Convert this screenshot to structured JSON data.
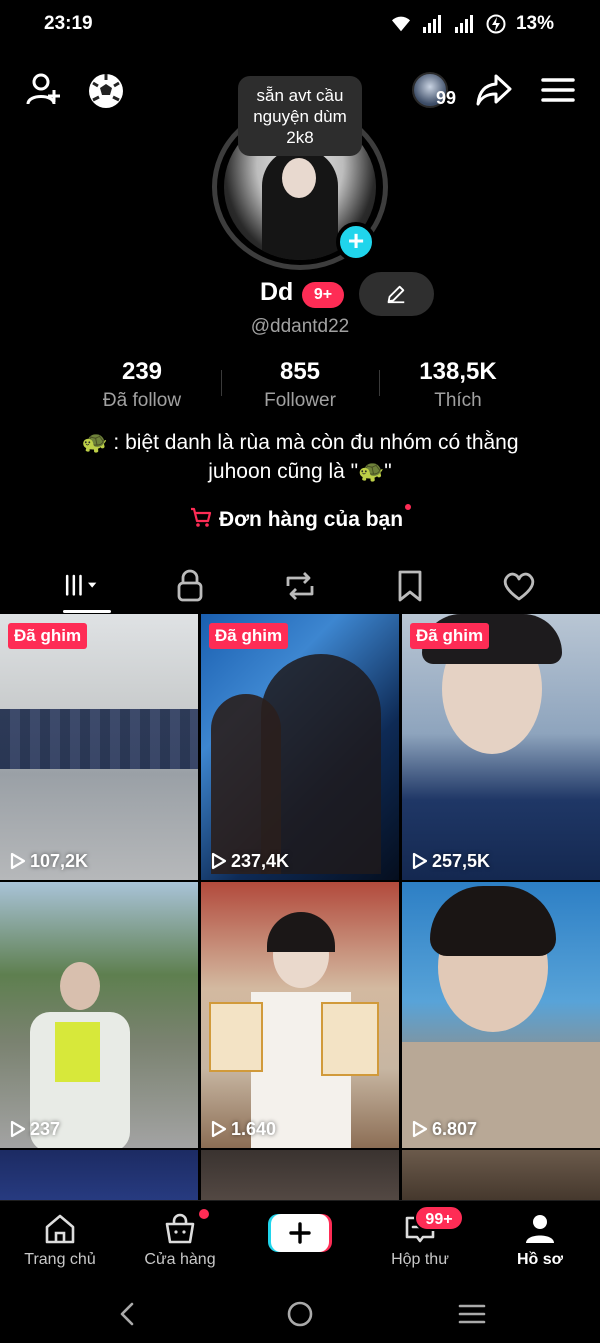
{
  "status_bar": {
    "time": "23:19",
    "battery": "13%"
  },
  "tooltip": {
    "text_line1": "sẵn avt cầu",
    "text_line2": "nguyện dùm",
    "text_line3": "2k8"
  },
  "top_bar": {
    "mini_count": "99"
  },
  "profile": {
    "name": "Dd",
    "name_badge": "9+",
    "handle": "@ddantd22",
    "stats": [
      {
        "value": "239",
        "label": "Đã follow"
      },
      {
        "value": "855",
        "label": "Follower"
      },
      {
        "value": "138,5K",
        "label": "Thích"
      }
    ],
    "bio_line1": "🐢 : biệt danh là rùa mà còn đu nhóm có thằng",
    "bio_line2": "juhoon cũng là \"🐢\"",
    "orders": "Đơn hàng của bạn"
  },
  "videos": [
    {
      "pinned": "Đã ghim",
      "views": "107,2K"
    },
    {
      "pinned": "Đã ghim",
      "views": "237,4K"
    },
    {
      "pinned": "Đã ghim",
      "views": "257,5K"
    },
    {
      "pinned": "",
      "views": "237"
    },
    {
      "pinned": "",
      "views": "1.640"
    },
    {
      "pinned": "",
      "views": "6.807"
    }
  ],
  "bottom_nav": {
    "home": "Trang chủ",
    "shop": "Cửa hàng",
    "inbox": "Hộp thư",
    "inbox_badge": "99+",
    "profile": "Hồ sơ"
  },
  "colors": {
    "accent": "#fe2c55",
    "cyan": "#20d5ec",
    "background": "#000000"
  }
}
